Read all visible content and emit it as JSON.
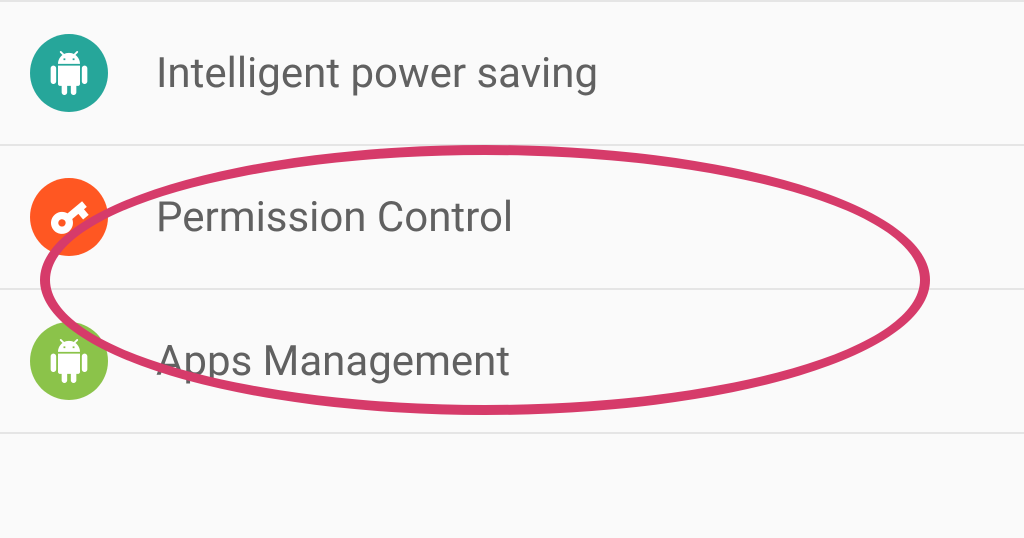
{
  "settings": {
    "items": [
      {
        "label": "Intelligent power saving",
        "icon": "android-icon",
        "color": "icon-teal"
      },
      {
        "label": "Permission Control",
        "icon": "key-icon",
        "color": "icon-orange"
      },
      {
        "label": "Apps Management",
        "icon": "android-icon",
        "color": "icon-green"
      }
    ]
  },
  "annotation": {
    "highlighted_item": "Permission Control"
  }
}
